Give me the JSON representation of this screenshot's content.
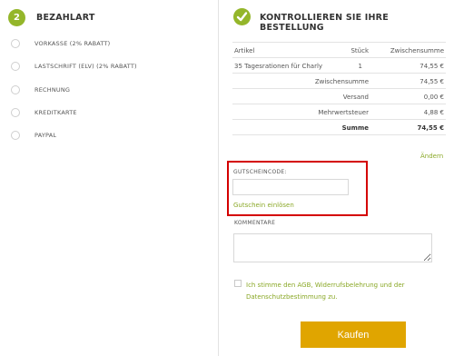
{
  "payment": {
    "step_number": "2",
    "title": "BEZAHLART",
    "options": [
      {
        "label": "VORKASSE (2% Rabatt)"
      },
      {
        "label": "LASTSCHRIFT (ELV) (2% Rabatt)"
      },
      {
        "label": "RECHNUNG"
      },
      {
        "label": "KREDITKARTE"
      },
      {
        "label": "PAYPAL"
      }
    ]
  },
  "review": {
    "title": "KONTROLLIEREN SIE IHRE BESTELLUNG",
    "table": {
      "headers": {
        "article": "Artikel",
        "qty": "Stück",
        "subtotal": "Zwischensumme"
      },
      "item": {
        "article": "35 Tagesrationen für Charly",
        "qty": "1",
        "subtotal": "74,55 €"
      },
      "rows": [
        {
          "label": "Zwischensumme",
          "value": "74,55 €"
        },
        {
          "label": "Versand",
          "value": "0,00 €"
        },
        {
          "label": "Mehrwertsteuer",
          "value": "4,88 €"
        }
      ],
      "total": {
        "label": "Summe",
        "value": "74,55 €"
      }
    },
    "change_link": "Ändern"
  },
  "coupon": {
    "label": "GUTSCHEINCODE:",
    "input_value": "",
    "redeem_link": "Gutschein einlösen"
  },
  "comments": {
    "label": "KOMMENTARE",
    "value": ""
  },
  "agb": {
    "text": "Ich stimme den AGB, Widerrufsbelehrung und der Datenschutzbestimmung zu."
  },
  "buy_button": "Kaufen",
  "colors": {
    "accent_green": "#94b62a",
    "link_green": "#8aa827",
    "highlight_red": "#d40000",
    "buy_orange": "#e0a500"
  }
}
